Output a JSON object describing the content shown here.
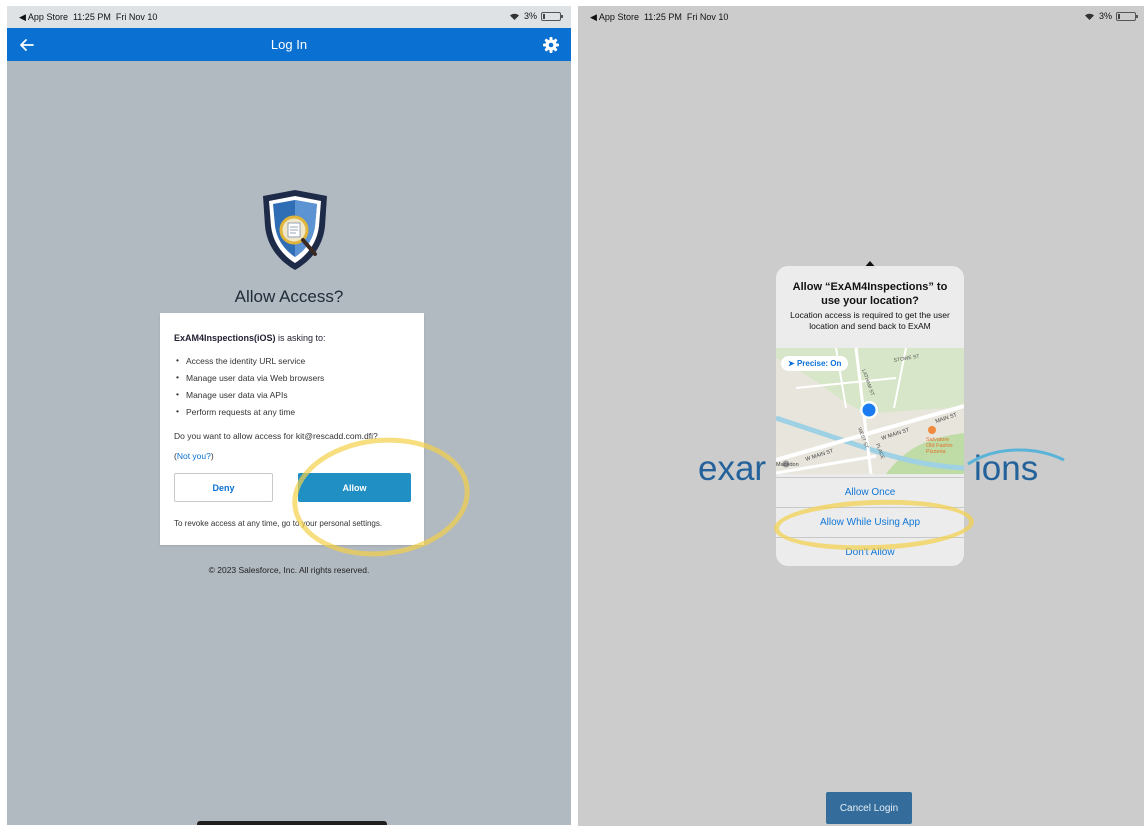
{
  "left": {
    "status_bar": {
      "back_label": "◀ App Store",
      "time": "11:25 PM",
      "date": "Fri Nov 10",
      "battery": "3%"
    },
    "nav": {
      "title": "Log In",
      "back_icon": "arrow-left-icon",
      "settings_icon": "gear-icon"
    },
    "logo_icon": "shield-magnifier-icon",
    "heading": "Allow Access?",
    "card": {
      "app_name": "ExAM4Inspections(iOS)",
      "asking": " is asking to:",
      "permissions": [
        "Access the identity URL service",
        "Manage user data via Web browsers",
        "Manage user data via APIs",
        "Perform requests at any time"
      ],
      "question": "Do you want to allow access for kit@rescadd.com.dfi?",
      "not_you_open": "(",
      "not_you_link": "Not you?",
      "not_you_close": ")",
      "deny_label": "Deny",
      "allow_label": "Allow",
      "revoke_text": "To revoke access at any time, go to your personal settings."
    },
    "footer": "© 2023 Salesforce, Inc. All rights reserved."
  },
  "right": {
    "status_bar": {
      "back_label": "◀ App Store",
      "time": "11:25 PM",
      "date": "Fri Nov 10",
      "battery": "3%"
    },
    "brand_left": "exar",
    "brand_right": "ions",
    "alert": {
      "title": "Allow “ExAM4Inspections” to use your location?",
      "message": "Location access is required to get the user location and send back to ExAM",
      "precise": "Precise: On",
      "map_labels": {
        "stowe": "STOWE ST",
        "latham": "LATHAM ST",
        "main_st": "MAIN ST",
        "w_main_st": "W MAIN ST",
        "w_main_st2": "W MAIN ST",
        "west": "WEST ST",
        "place": "PLACE",
        "salvatore": "Salvatore",
        "old_fashion": "Old Fashio",
        "pizzeria": "Pizzeria",
        "macedon": "Macedon"
      },
      "buttons": [
        "Allow Once",
        "Allow While Using App",
        "Don't Allow"
      ]
    },
    "cancel_login": "Cancel Login"
  },
  "colors": {
    "nav_blue": "#0a70d2",
    "allow_button": "#1f8fc4",
    "highlight": "#f4d049",
    "brand": "#23629a"
  }
}
